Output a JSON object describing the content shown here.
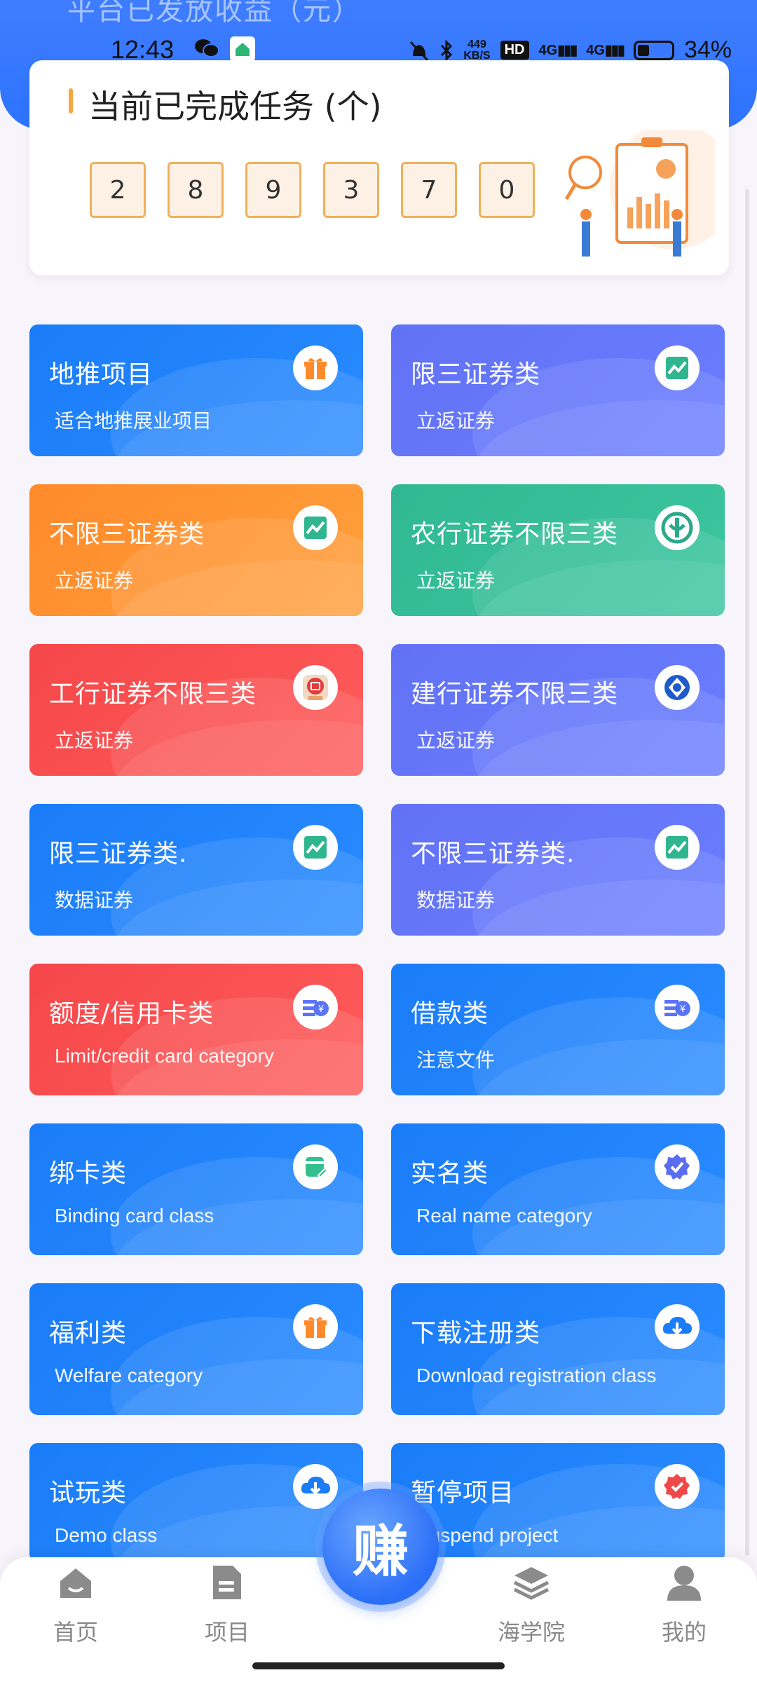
{
  "header": {
    "faded_text": "平台已发放收益（元）"
  },
  "status_bar": {
    "time": "12:43",
    "net_speed_top": "449",
    "net_speed_bottom": "KB/S",
    "hd": "HD",
    "sig1": "4G",
    "sig2": "4G",
    "battery": "34%"
  },
  "completed": {
    "title": "当前已完成任务 (个)",
    "digits": [
      "2",
      "8",
      "9",
      "3",
      "7",
      "0"
    ]
  },
  "tiles": [
    {
      "title": "地推项目",
      "subtitle": "适合地推展业项目",
      "color": "blue",
      "icon": "gift-icon"
    },
    {
      "title": "限三证券类",
      "subtitle": "立返证券",
      "color": "purple",
      "icon": "chart-up-icon"
    },
    {
      "title": "不限三证券类",
      "subtitle": "立返证券",
      "color": "orange",
      "icon": "chart-up-icon"
    },
    {
      "title": "农行证券不限三类",
      "subtitle": "立返证券",
      "color": "green",
      "icon": "abc-bank-icon"
    },
    {
      "title": "工行证券不限三类",
      "subtitle": "立返证券",
      "color": "red",
      "icon": "icbc-bank-icon"
    },
    {
      "title": "建行证券不限三类",
      "subtitle": "立返证券",
      "color": "purple",
      "icon": "ccb-bank-icon"
    },
    {
      "title": "限三证券类.",
      "subtitle": "数据证券",
      "color": "blue",
      "icon": "chart-up-icon"
    },
    {
      "title": "不限三证券类.",
      "subtitle": "数据证券",
      "color": "purple",
      "icon": "chart-up-icon"
    },
    {
      "title": "额度/信用卡类",
      "subtitle": "Limit/credit card category",
      "color": "red",
      "icon": "yen-card-icon"
    },
    {
      "title": "借款类",
      "subtitle": "注意文件",
      "color": "blue",
      "icon": "yen-card-icon"
    },
    {
      "title": "绑卡类",
      "subtitle": "Binding card class",
      "color": "blue",
      "icon": "card-edit-icon"
    },
    {
      "title": "实名类",
      "subtitle": "Real name category",
      "color": "blue",
      "icon": "verified-badge-icon"
    },
    {
      "title": "福利类",
      "subtitle": "Welfare category",
      "color": "blue",
      "icon": "gift-icon"
    },
    {
      "title": "下载注册类",
      "subtitle": "Download registration class",
      "color": "blue",
      "icon": "cloud-download-icon"
    },
    {
      "title": "试玩类",
      "subtitle": "Demo class",
      "color": "blue",
      "icon": "cloud-download-icon"
    },
    {
      "title": "暂停项目",
      "subtitle": "Suspend project",
      "color": "blue",
      "icon": "red-badge-icon"
    }
  ],
  "nav": {
    "home": "首页",
    "projects": "项目",
    "earn": "赚",
    "academy": "海学院",
    "mine": "我的"
  }
}
